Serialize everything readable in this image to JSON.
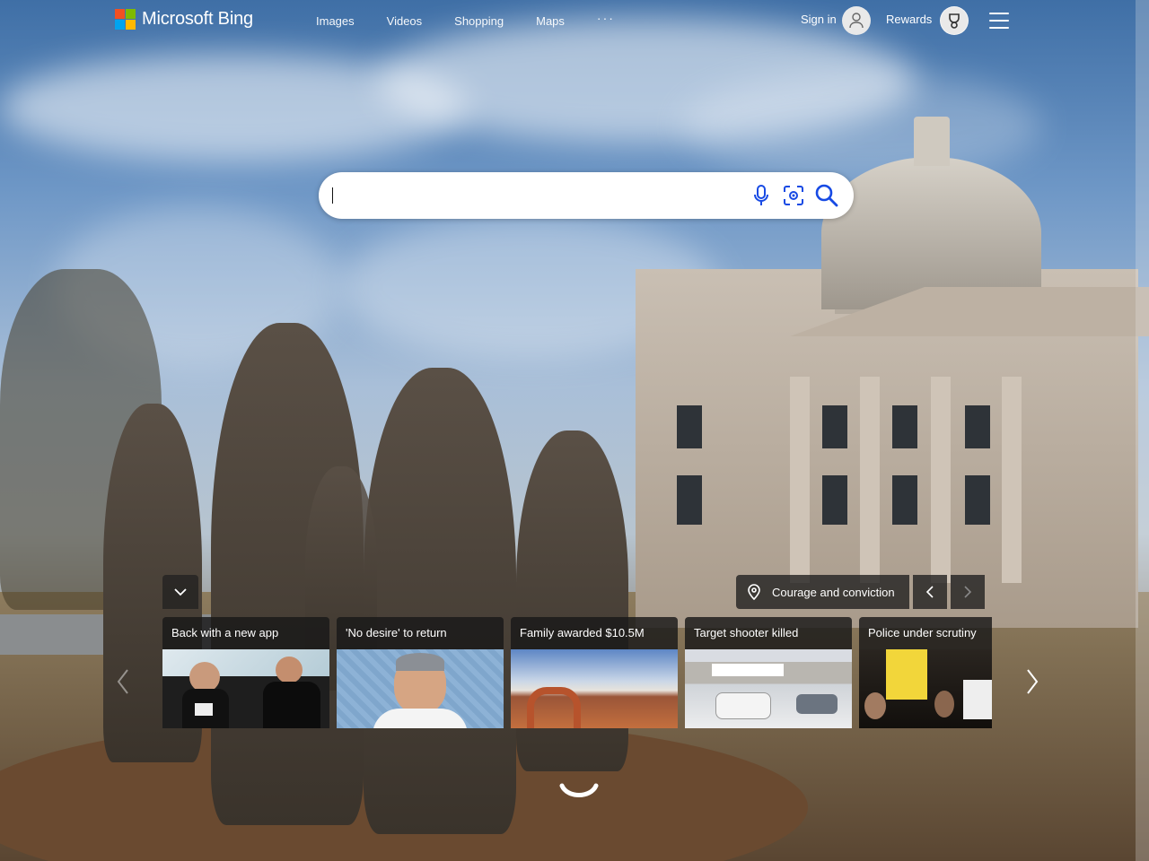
{
  "brand": {
    "name": "Microsoft Bing",
    "colors": [
      "#f25022",
      "#7fba00",
      "#00a4ef",
      "#ffb900"
    ]
  },
  "nav": {
    "items": [
      "Images",
      "Videos",
      "Shopping",
      "Maps"
    ],
    "more": "···"
  },
  "account": {
    "sign_in": "Sign in",
    "rewards": "Rewards"
  },
  "search": {
    "value": "",
    "placeholder": ""
  },
  "image_info": {
    "title": "Courage and conviction",
    "location_icon": "location-pin-icon"
  },
  "news": [
    {
      "title": "Back with a new app"
    },
    {
      "title": "'No desire' to return"
    },
    {
      "title": "Family awarded $10.5M"
    },
    {
      "title": "Target shooter killed"
    },
    {
      "title": "Police under scrutiny"
    }
  ]
}
